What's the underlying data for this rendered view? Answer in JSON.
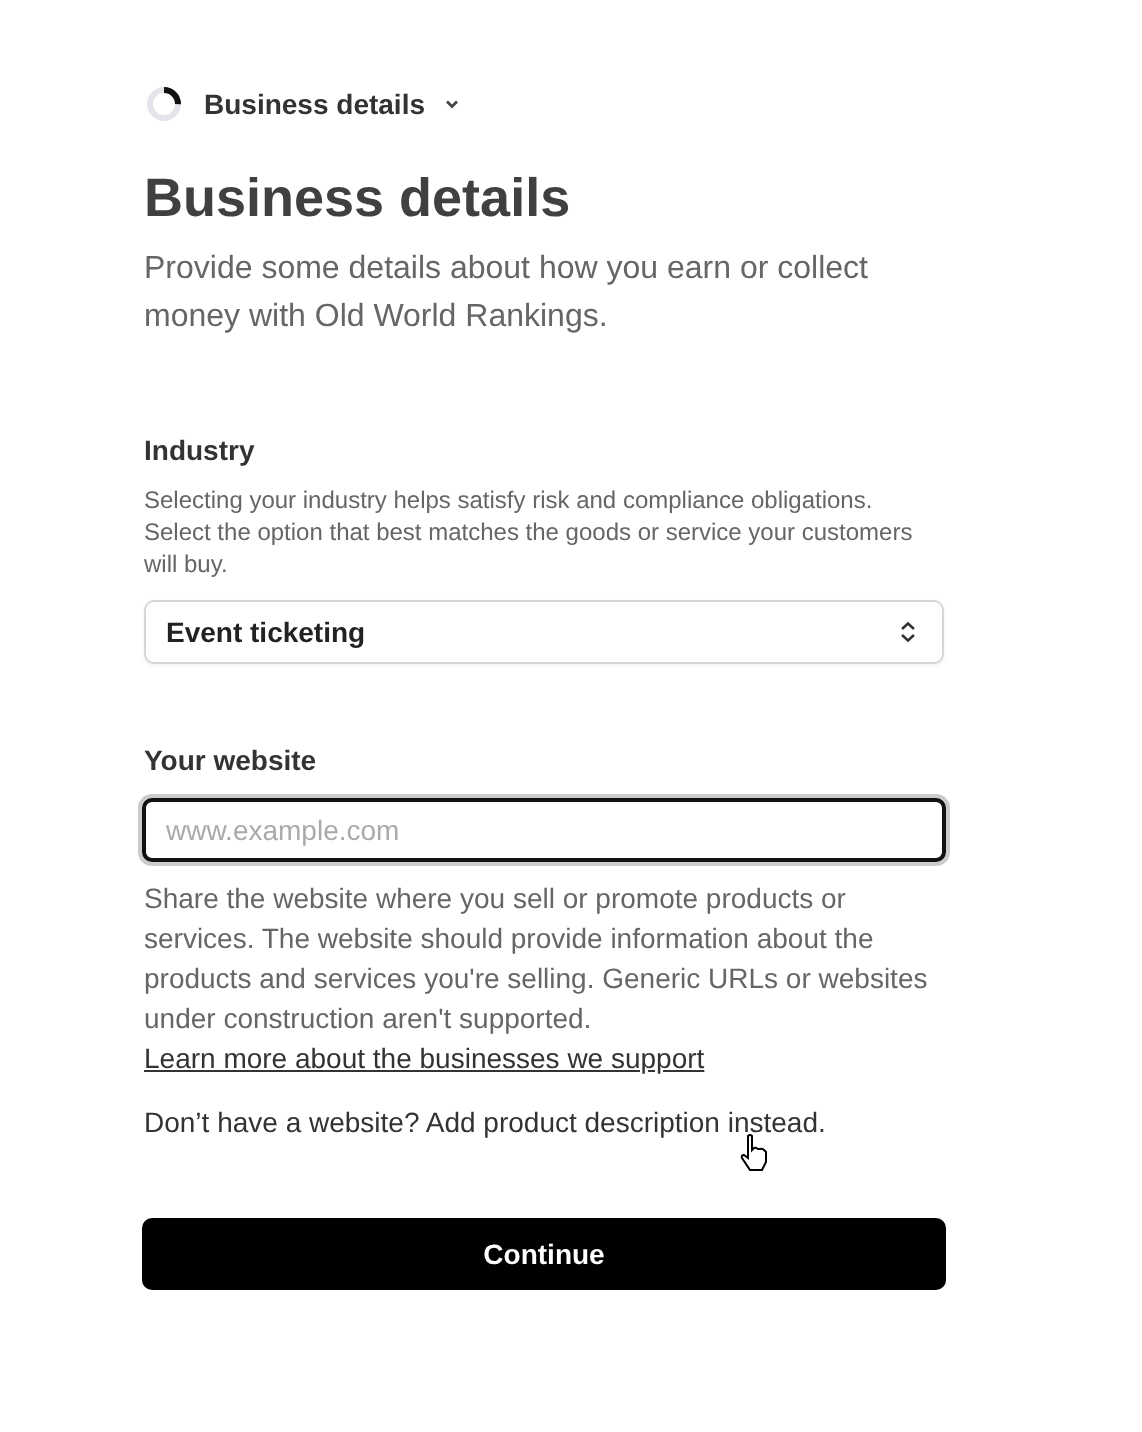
{
  "breadcrumb": {
    "label": "Business details",
    "progress": {
      "level": 0.25
    }
  },
  "title": "Business details",
  "subtitle": "Provide some details about how you earn or collect money with Old World Rankings.",
  "industry": {
    "label": "Industry",
    "help": "Selecting your industry helps satisfy risk and compliance obligations. Select the option that best matches the goods or service your customers will buy.",
    "value": "Event ticketing"
  },
  "website": {
    "label": "Your website",
    "placeholder": "www.example.com",
    "focused": true,
    "help": "Share the website where you sell or promote products or services. The website should provide information about the products and services you're selling. Generic URLs or websites under construction aren't supported.",
    "link": "Learn more about the businesses we support"
  },
  "no_website": "Don’t have a website? Add product description instead.",
  "continue_button": "Continue"
}
